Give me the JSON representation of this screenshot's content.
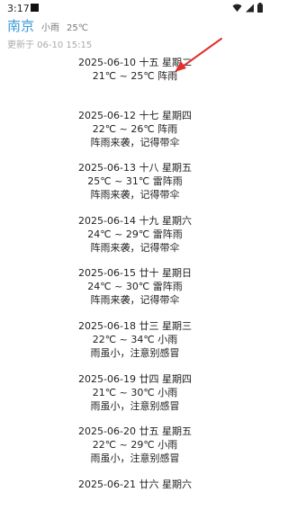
{
  "status": {
    "time": "3:17"
  },
  "header": {
    "city": "南京",
    "weather": "小雨",
    "temp": "25℃",
    "updated": "更新于 06-10 15:15"
  },
  "forecast": [
    {
      "date_line": "2025-06-10  十五  星期二",
      "temp_line": "21℃ ~ 25℃  阵雨",
      "tip": ""
    },
    {
      "date_line": "2025-06-12  十七  星期四",
      "temp_line": "22℃ ~ 26℃  阵雨",
      "tip": "阵雨来袭，记得带伞"
    },
    {
      "date_line": "2025-06-13  十八  星期五",
      "temp_line": "25℃ ~ 31℃  雷阵雨",
      "tip": "阵雨来袭，记得带伞"
    },
    {
      "date_line": "2025-06-14  十九  星期六",
      "temp_line": "24℃ ~ 29℃  雷阵雨",
      "tip": "阵雨来袭，记得带伞"
    },
    {
      "date_line": "2025-06-15  廿十  星期日",
      "temp_line": "24℃ ~ 30℃  雷阵雨",
      "tip": "阵雨来袭，记得带伞"
    },
    {
      "date_line": "2025-06-18  廿三  星期三",
      "temp_line": "22℃ ~ 34℃  小雨",
      "tip": "雨虽小，注意别感冒"
    },
    {
      "date_line": "2025-06-19  廿四  星期四",
      "temp_line": "21℃ ~ 30℃  小雨",
      "tip": "雨虽小，注意别感冒"
    },
    {
      "date_line": "2025-06-20  廿五  星期五",
      "temp_line": "22℃ ~ 29℃  小雨",
      "tip": "雨虽小，注意别感冒"
    },
    {
      "date_line": "2025-06-21  廿六  星期六",
      "temp_line": "",
      "tip": ""
    }
  ],
  "colors": {
    "city": "#3a9ad9",
    "arrow": "#e03030"
  }
}
